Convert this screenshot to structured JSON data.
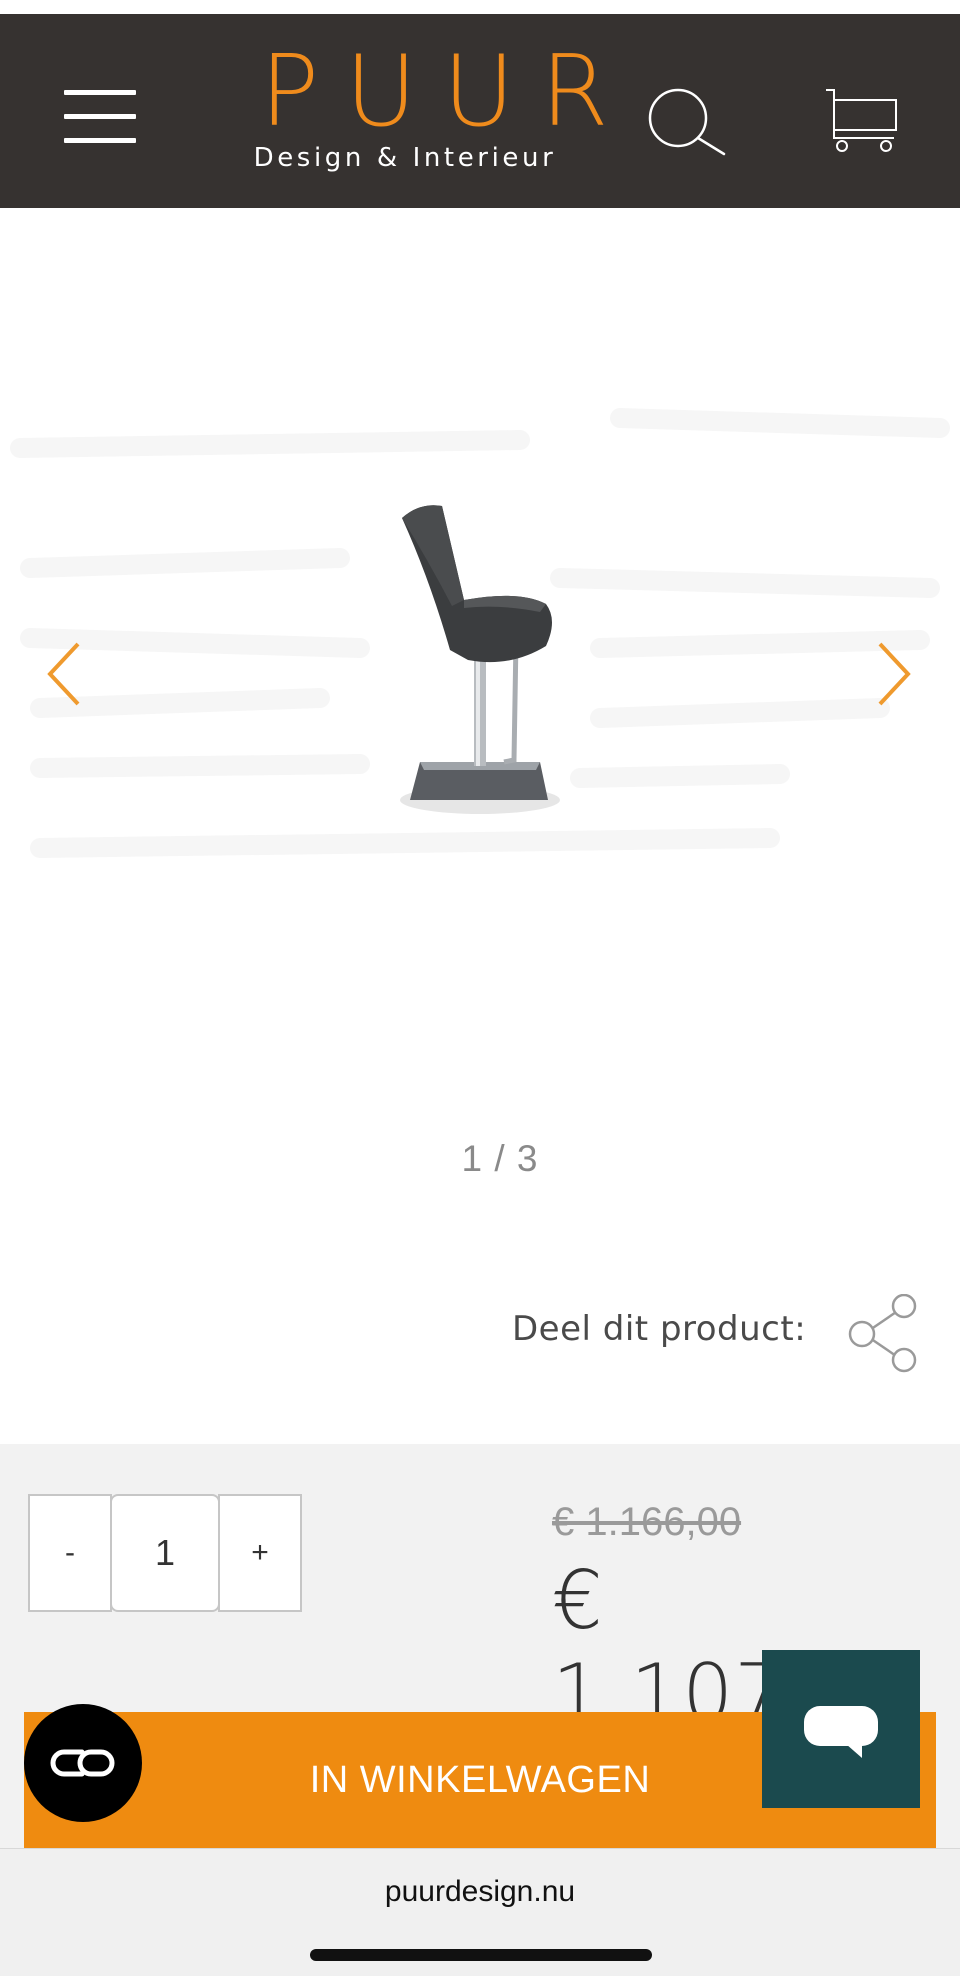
{
  "header": {
    "logo_main": "PUUR",
    "logo_sub": "Design & Interieur"
  },
  "gallery": {
    "counter": "1 / 3"
  },
  "share": {
    "label": "Deel dit product:"
  },
  "purchase": {
    "quantity_minus": "-",
    "quantity_value": "1",
    "quantity_plus": "+",
    "old_price": "€ 1.166,00",
    "price": "€ 1.107,70",
    "add_to_cart_label": "IN WINKELWAGEN"
  },
  "browser": {
    "url": "puurdesign.nu"
  },
  "colors": {
    "header_bg": "#363230",
    "brand_orange": "#ef8b10",
    "chat_teal": "#1b4a4e",
    "panel_bg": "#f2f2f2"
  },
  "icons": [
    "hamburger-menu-icon",
    "search-icon",
    "cart-icon",
    "chevron-left-icon",
    "chevron-right-icon",
    "share-icon",
    "chat-bubble-icon",
    "link-icon"
  ]
}
